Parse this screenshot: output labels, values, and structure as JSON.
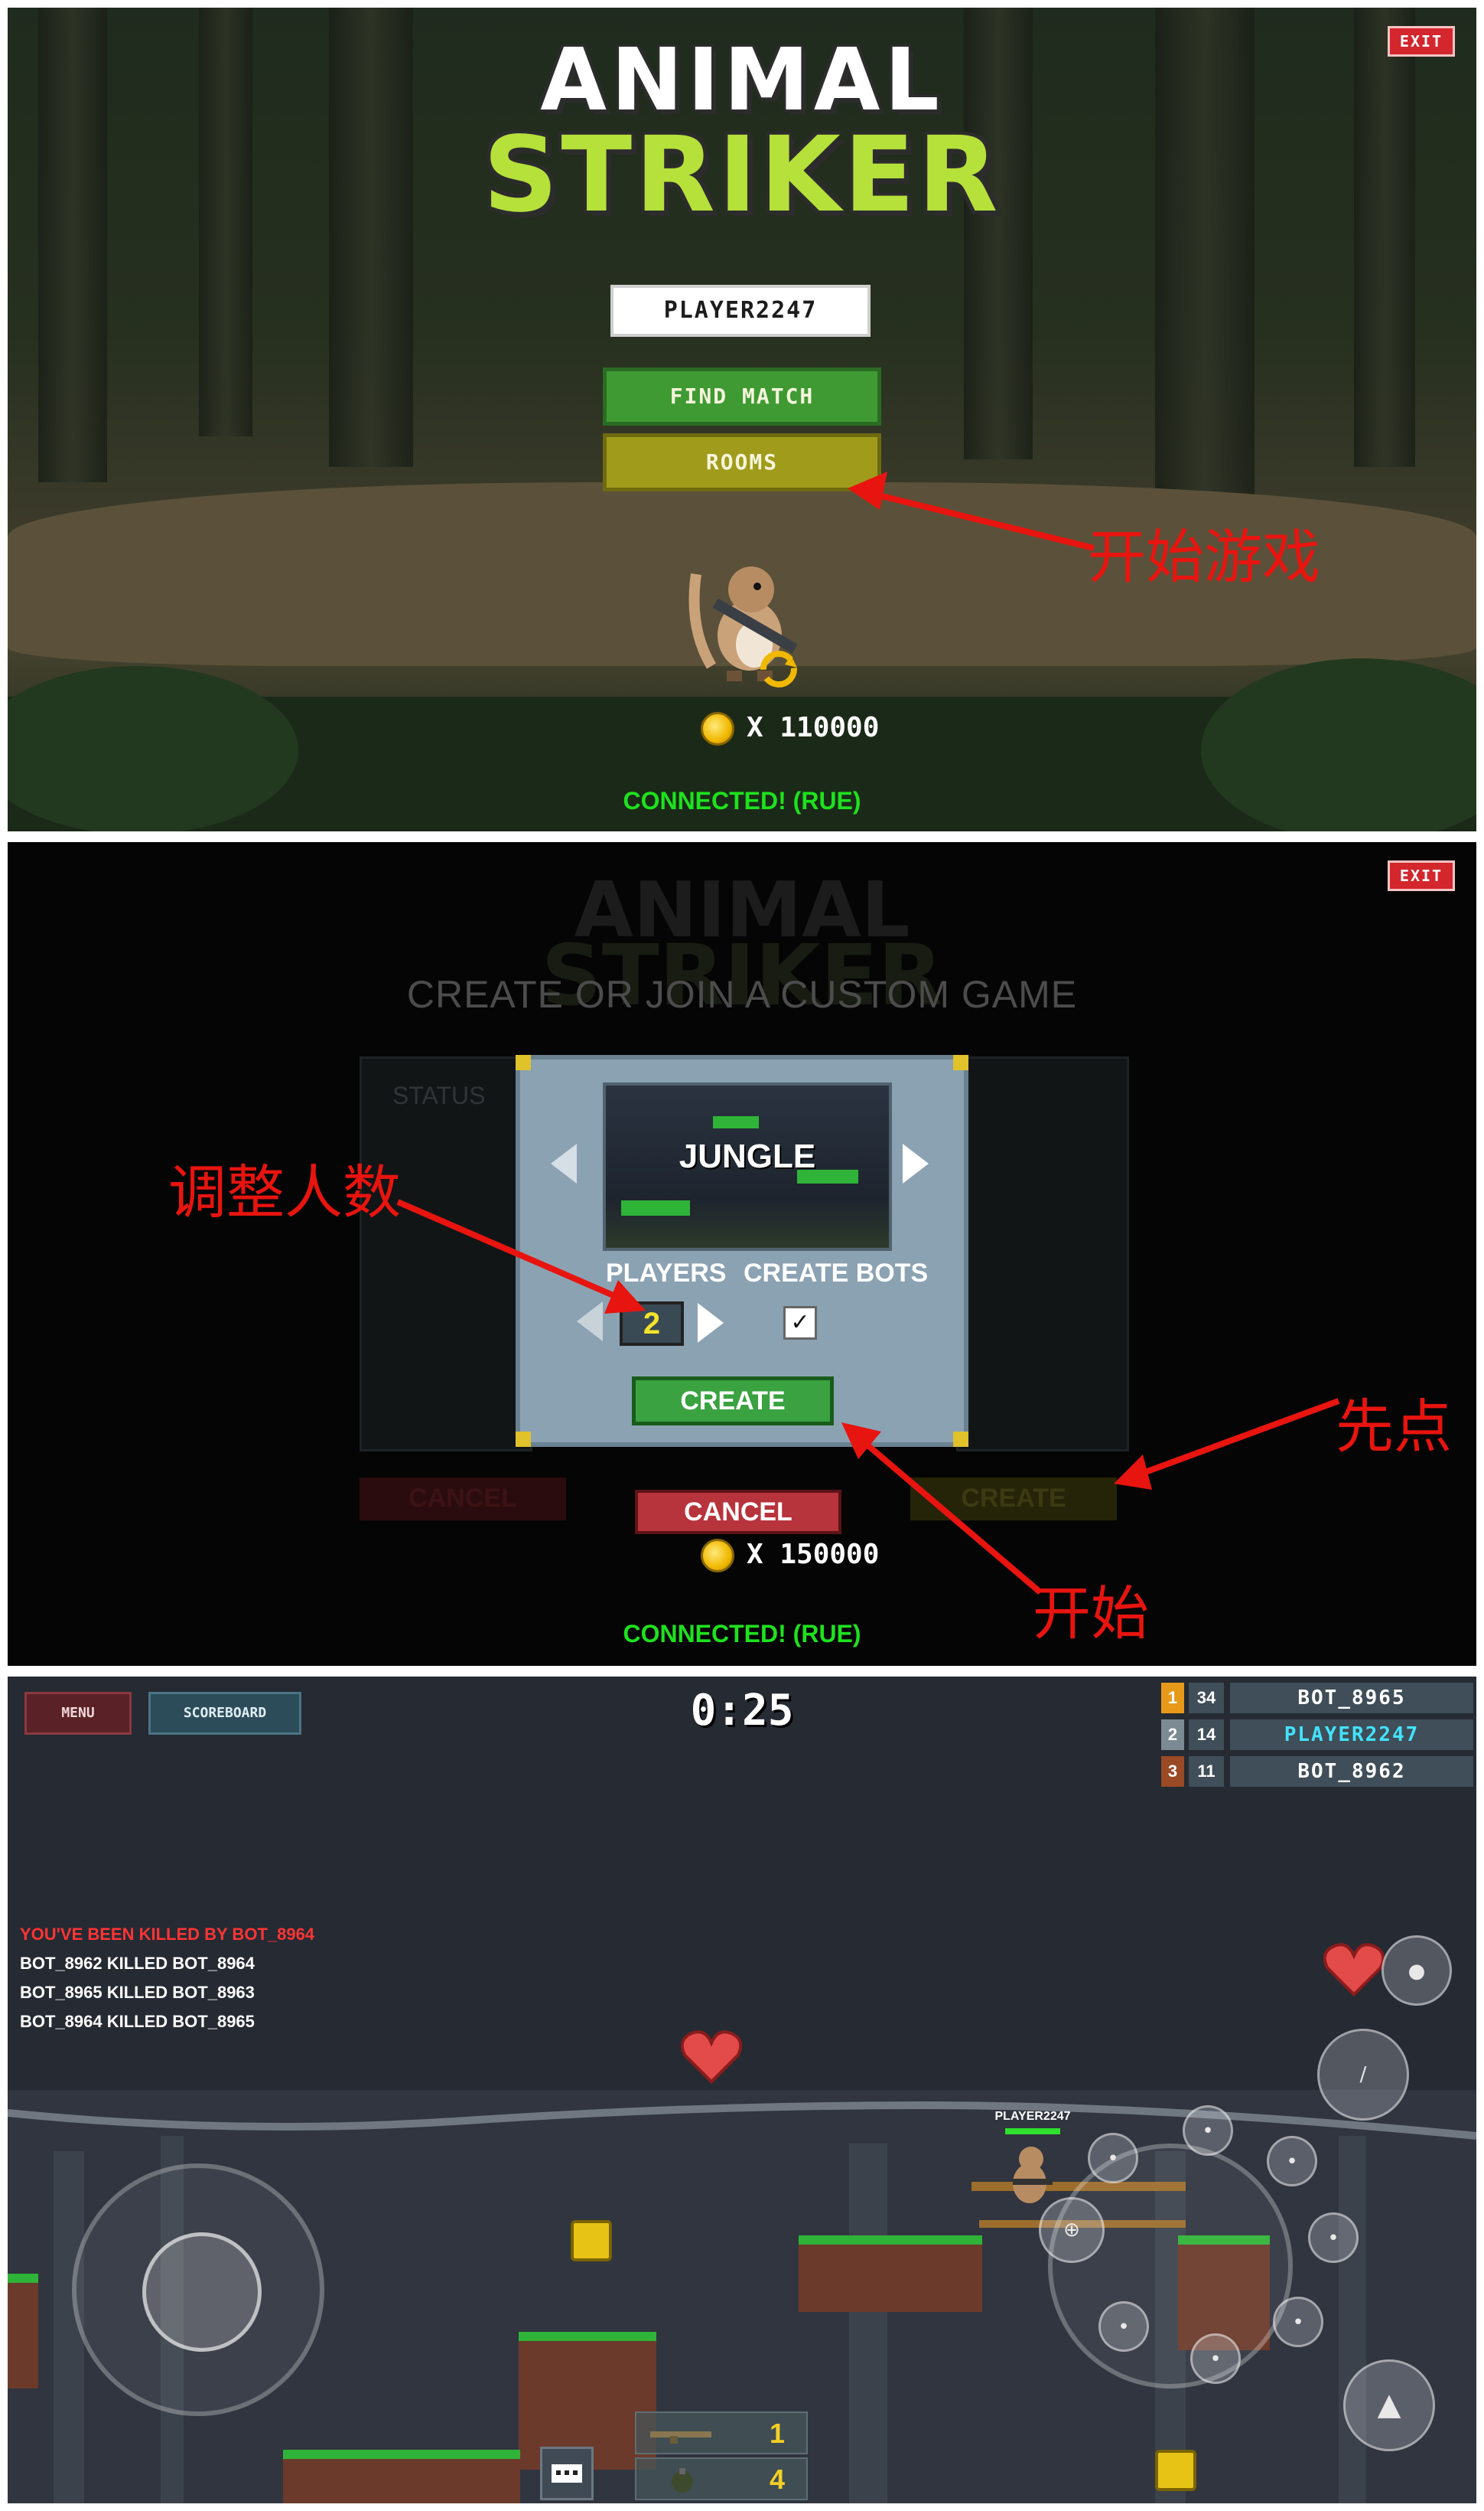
{
  "panel1": {
    "logo_line1": "ANIMAL",
    "logo_line2": "STRIKER",
    "exit_label": "EXIT",
    "player_name": "PLAYER2247",
    "find_match_label": "FIND MATCH",
    "rooms_label": "ROOMS",
    "coins": "X 110000",
    "status": "CONNECTED! (RUE)",
    "annotation": "开始游戏"
  },
  "panel2": {
    "exit_label": "EXIT",
    "logo_line1": "ANIMAL",
    "logo_line2": "STRIKER",
    "title": "CREATE OR JOIN A CUSTOM GAME",
    "status_label": "STATUS",
    "map_name": "JUNGLE",
    "players_label": "PLAYERS",
    "players_value": "2",
    "create_bots_label": "CREATE BOTS",
    "create_bots_checked": true,
    "create_label": "CREATE",
    "cancel_label": "CANCEL",
    "back_cancel_label": "CANCEL",
    "back_create_label": "CREATE",
    "coins": "X 150000",
    "status": "CONNECTED! (RUE)",
    "annotation_players": "调整人数",
    "annotation_first": "先点",
    "annotation_start": "开始"
  },
  "panel3": {
    "menu_label": "MENU",
    "scoreboard_label": "SCOREBOARD",
    "timer": "0:25",
    "leaderboard": [
      {
        "rank": "1",
        "kills": "34",
        "name": "BOT_8965",
        "rank_color": "#e79a1a",
        "name_color": "#ffffff"
      },
      {
        "rank": "2",
        "kills": "14",
        "name": "PLAYER2247",
        "rank_color": "#7c8a93",
        "name_color": "#43e3ff"
      },
      {
        "rank": "3",
        "kills": "11",
        "name": "BOT_8962",
        "rank_color": "#9a4a25",
        "name_color": "#ffffff"
      }
    ],
    "kill_feed": [
      {
        "text": "YOU'VE BEEN KILLED BY BOT_8964",
        "color": "#ff3434"
      },
      {
        "text": "BOT_8962 KILLED BOT_8964",
        "color": "#ffffff"
      },
      {
        "text": "BOT_8965 KILLED BOT_8963",
        "color": "#ffffff"
      },
      {
        "text": "BOT_8964 KILLED BOT_8965",
        "color": "#ffffff"
      }
    ],
    "player_tag": "PLAYER2247",
    "weapon_ammo": "1",
    "grenade_count": "4"
  },
  "colors": {
    "annotation_red": "#e8140f",
    "status_green": "#1ee21e",
    "logo_green": "#b6e03a"
  },
  "icons": [
    "exit-icon",
    "coin-icon",
    "refresh-icon",
    "heart-icon",
    "grenade-icon",
    "knife-icon",
    "jump-arrow-icon",
    "chat-icon",
    "ammo-crate-icon",
    "rifle-icon"
  ]
}
